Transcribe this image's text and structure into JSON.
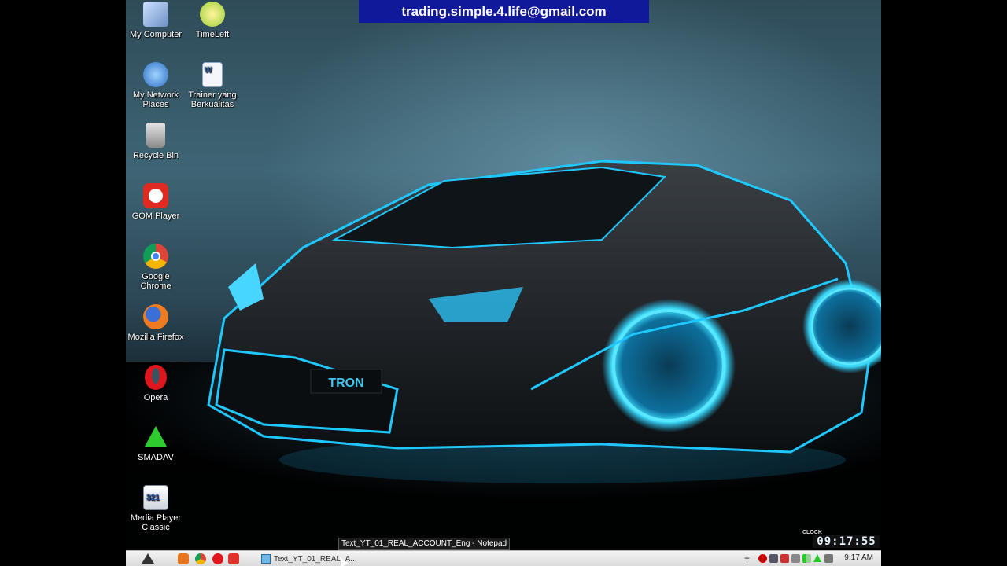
{
  "banner": {
    "text": "trading.simple.4.life@gmail.com"
  },
  "desktop_icons": [
    {
      "label": "My Computer",
      "icon": "my-computer-icon"
    },
    {
      "label": "TimeLeft",
      "icon": "clock-icon"
    },
    {
      "label": "My Network Places",
      "icon": "network-globe-icon"
    },
    {
      "label": "Trainer yang Berkualitas",
      "icon": "word-document-icon"
    },
    {
      "label": "Recycle Bin",
      "icon": "recycle-bin-icon"
    },
    {
      "label": "GOM Player",
      "icon": "gom-player-icon"
    },
    {
      "label": "Google Chrome",
      "icon": "chrome-icon"
    },
    {
      "label": "Mozilla Firefox",
      "icon": "firefox-icon"
    },
    {
      "label": "Opera",
      "icon": "opera-icon"
    },
    {
      "label": "SMADAV",
      "icon": "smadav-icon"
    },
    {
      "label": "Media Player Classic",
      "icon": "media-player-classic-icon"
    }
  ],
  "wallpaper": {
    "plate_text": "TRON",
    "accent": "#1ec8ff"
  },
  "taskbar": {
    "task_label": "Text_YT_01_REAL_A...",
    "tooltip": "Text_YT_01_REAL_ACCOUNT_Eng - Notepad",
    "time": "9:17 AM"
  },
  "clock_widget": {
    "label": "CLOCK",
    "time": "09:17:55"
  }
}
